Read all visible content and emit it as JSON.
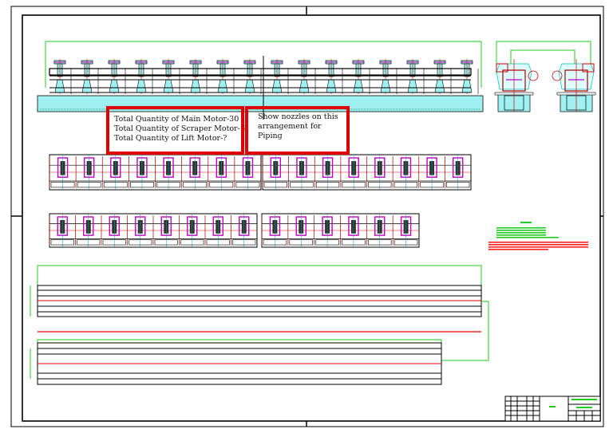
{
  "annotations": {
    "motor_quantities": [
      "Total Quantity of Main Motor-30",
      "Total Quantity of Scraper Motor- ?",
      "Total Quantity of Lift Motor-?"
    ],
    "piping_note": "Show nozzles on this arrangement for Piping"
  },
  "colors": {
    "frame": "#000000",
    "dimension": "#22cc22",
    "centerline": "#e00000",
    "base": "#9ff0f0",
    "motor": "#c000c0",
    "highlight": "#e00000"
  },
  "drawing": {
    "elevation_units": 16,
    "plan_row1_units": 16,
    "plan_row2_group1_units": 8,
    "plan_row2_group2_units": 6
  }
}
